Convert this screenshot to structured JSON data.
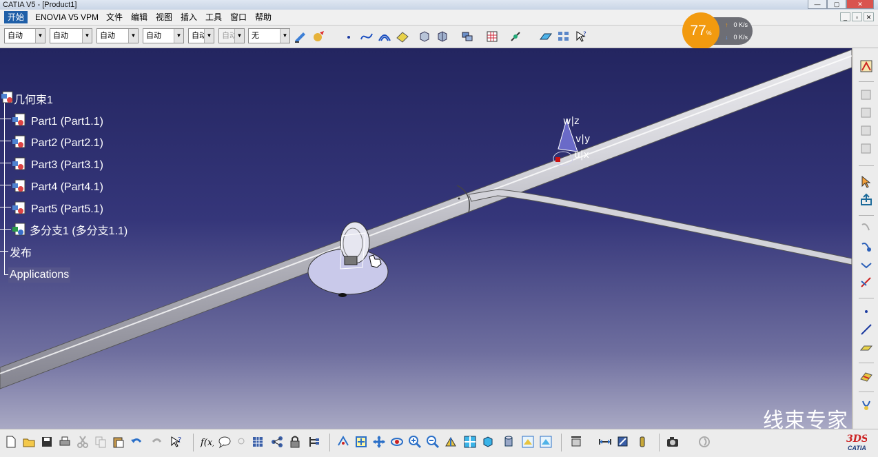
{
  "window": {
    "title": "CATIA V5 - [Product1]",
    "minimize": "—",
    "restore": "▢",
    "close": "✕"
  },
  "menu": {
    "items": [
      "开始",
      "ENOVIA V5 VPM",
      "文件",
      "编辑",
      "视图",
      "插入",
      "工具",
      "窗口",
      "帮助"
    ],
    "mdi_minimize": "_",
    "mdi_restore": "▫",
    "mdi_close": "✕"
  },
  "toolbar": {
    "combos": [
      {
        "value": "自动"
      },
      {
        "value": "自动"
      },
      {
        "value": "自动"
      },
      {
        "value": "自动"
      },
      {
        "value": "自动"
      },
      {
        "value": "自动"
      },
      {
        "value": "无"
      }
    ],
    "combo_arrow": "▼"
  },
  "tree": {
    "root": "几何束1",
    "items": [
      {
        "label": "Part1 (Part1.1)",
        "icon": "part-icon"
      },
      {
        "label": "Part2 (Part2.1)",
        "icon": "part-icon"
      },
      {
        "label": "Part3 (Part3.1)",
        "icon": "part-icon"
      },
      {
        "label": "Part4 (Part4.1)",
        "icon": "part-icon"
      },
      {
        "label": "Part5 (Part5.1)",
        "icon": "part-icon"
      },
      {
        "label": "多分支1 (多分支1.1)",
        "icon": "multi-branch-icon"
      }
    ],
    "publish": "发布",
    "applications": "Applications"
  },
  "compass": {
    "w": "w",
    "z": "z",
    "v": "v",
    "y": "y",
    "u": "u",
    "x": "x"
  },
  "speed": {
    "percent": "77",
    "percent_sign": "%",
    "up": "0 K/s",
    "down": "0 K/s",
    "up_arrow": "↑",
    "down_arrow": "↓"
  },
  "watermark": {
    "text": "线束专家"
  },
  "logo": {
    "text": "CATIA",
    "small": "3DS"
  },
  "colors": {
    "viewport_top": "#232560",
    "viewport_bottom": "#a9a9c4",
    "accent": "#f29a0f",
    "menu_active": "#1f5fa8"
  }
}
